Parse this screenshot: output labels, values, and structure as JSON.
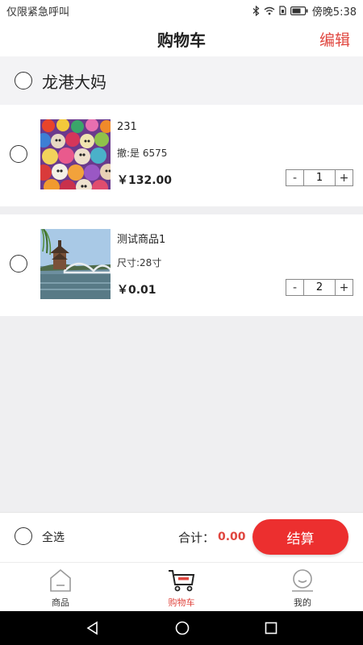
{
  "status": {
    "carrier": "仅限紧急呼叫",
    "time": "傍晚5:38"
  },
  "header": {
    "title": "购物车",
    "edit_label": "编辑"
  },
  "store": {
    "name": "龙港大妈"
  },
  "items": [
    {
      "title": "231",
      "spec": "撤:是 6575",
      "price": "￥132.00",
      "qty": "1",
      "minus": "-",
      "plus": "+"
    },
    {
      "title": "测试商品1",
      "spec": "尺寸:28寸",
      "price": "￥0.01",
      "qty": "2",
      "minus": "-",
      "plus": "+"
    }
  ],
  "footer": {
    "select_all": "全选",
    "total_label": "合计：",
    "total_value": "0.00",
    "checkout_label": "结算"
  },
  "tabs": [
    {
      "label": "商品",
      "icon": "home-icon"
    },
    {
      "label": "购物车",
      "icon": "cart-icon",
      "active": true
    },
    {
      "label": "我的",
      "icon": "profile-icon"
    }
  ],
  "colors": {
    "accent": "#e0463f",
    "checkout": "#ec2f2f",
    "background": "#efeff1"
  }
}
